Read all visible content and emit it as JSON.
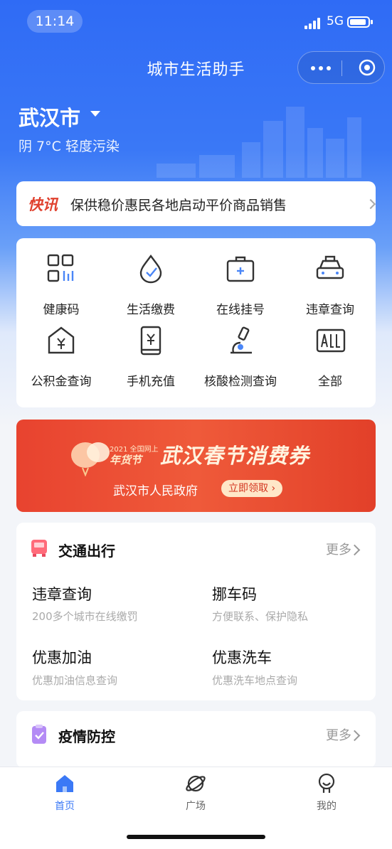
{
  "status_bar": {
    "time": "11:14",
    "network": "5G"
  },
  "nav": {
    "title": "城市生活助手"
  },
  "location": {
    "city": "武汉市",
    "weather": "阴 7°C 轻度污染"
  },
  "news": {
    "tag": "快讯",
    "text": "保供稳价惠民各地启动平价商品销售"
  },
  "services": [
    {
      "label": "健康码",
      "icon": "qr-code-icon"
    },
    {
      "label": "生活缴费",
      "icon": "water-drop-icon"
    },
    {
      "label": "在线挂号",
      "icon": "medical-kit-icon"
    },
    {
      "label": "违章查询",
      "icon": "car-icon"
    },
    {
      "label": "公积金查询",
      "icon": "house-yuan-icon"
    },
    {
      "label": "手机充值",
      "icon": "phone-yuan-icon"
    },
    {
      "label": "核酸检测查询",
      "icon": "microscope-icon"
    },
    {
      "label": "全部",
      "icon": "all-icon"
    }
  ],
  "banner": {
    "tag_line1": "2021 全国网上",
    "tag_line2": "年货节",
    "title": "武汉春节消费券",
    "org": "武汉市人民政府",
    "cta": "立即领取 ›",
    "colors": {
      "background": "#e8432f",
      "cta_bg": "#ffe7c8"
    }
  },
  "traffic": {
    "title": "交通出行",
    "more": "更多",
    "items": [
      {
        "title": "违章查询",
        "subtitle": "200多个城市在线缴罚"
      },
      {
        "title": "挪车码",
        "subtitle": "方便联系、保护隐私"
      },
      {
        "title": "优惠加油",
        "subtitle": "优惠加油信息查询"
      },
      {
        "title": "优惠洗车",
        "subtitle": "优惠洗车地点查询"
      }
    ]
  },
  "epidemic": {
    "title": "疫情防控",
    "more": "更多"
  },
  "tabbar": {
    "tabs": [
      {
        "label": "首页",
        "icon": "home-icon",
        "active": true
      },
      {
        "label": "广场",
        "icon": "planet-icon",
        "active": false
      },
      {
        "label": "我的",
        "icon": "user-icon",
        "active": false
      }
    ],
    "active_color": "#3b79f6"
  },
  "theme": {
    "primary": "#2f6bf5"
  }
}
